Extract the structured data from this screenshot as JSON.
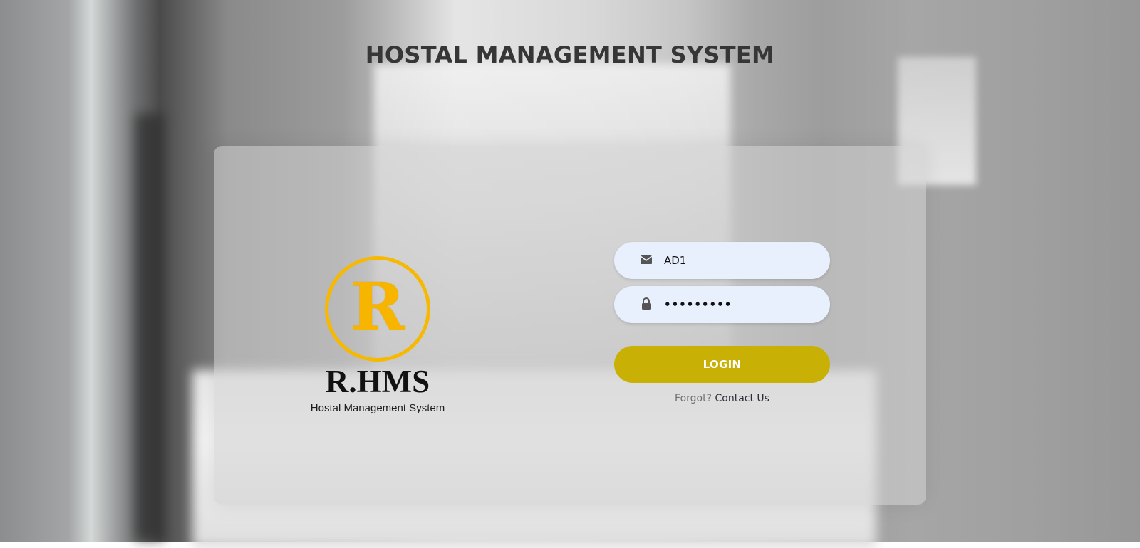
{
  "page": {
    "title": "HOSTAL MANAGEMENT SYSTEM"
  },
  "logo": {
    "letter": "R",
    "brand": "R.HMS",
    "subtitle": "Hostal Management System"
  },
  "form": {
    "username_value": "AD1",
    "password_value": "•••••••••",
    "login_label": "LOGIN",
    "forgot_label": "Forgot?",
    "contact_label": "Contact Us"
  },
  "icons": {
    "username": "envelope-icon",
    "password": "lock-icon"
  },
  "colors": {
    "title": "#363636",
    "input_bg": "#e8effd",
    "login_button": "#c8b005",
    "logo_gold": "#f6b800"
  }
}
